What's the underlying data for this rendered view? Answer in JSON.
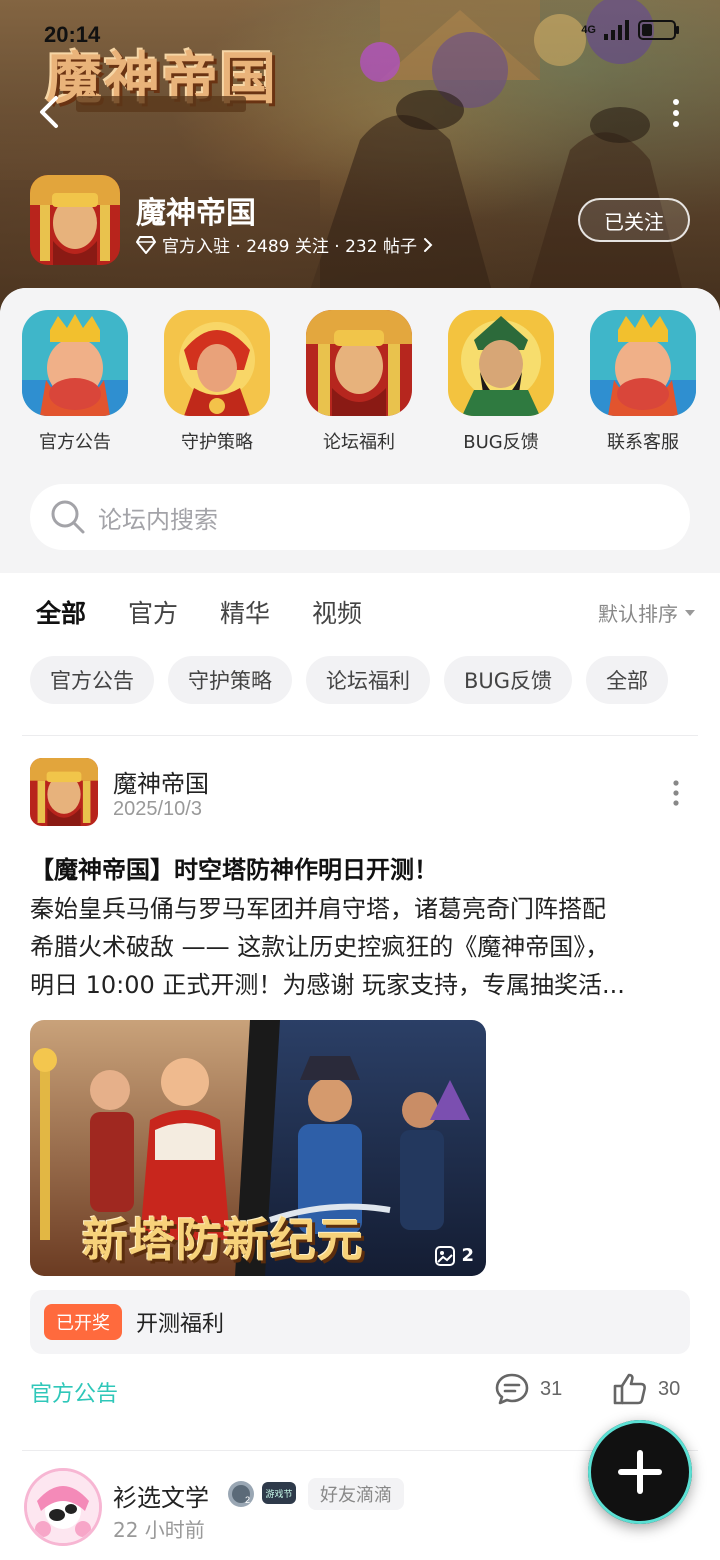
{
  "status": {
    "time": "20:14",
    "network": "4G"
  },
  "header": {
    "logo_text": "魔神帝国",
    "game_name": "魔神帝国",
    "meta": "官方入驻 · 2489 关注 · 232 帖子",
    "follow_label": "已关注"
  },
  "quick_links": [
    {
      "label": "官方公告",
      "icon": "king-icon"
    },
    {
      "label": "守护策略",
      "icon": "red-hero-icon"
    },
    {
      "label": "论坛福利",
      "icon": "emperor-icon"
    },
    {
      "label": "BUG反馈",
      "icon": "guan-yu-icon"
    },
    {
      "label": "联系客服",
      "icon": "king-icon"
    }
  ],
  "search": {
    "placeholder": "论坛内搜索"
  },
  "tabs": [
    "全部",
    "官方",
    "精华",
    "视频"
  ],
  "active_tab": "全部",
  "sort_label": "默认排序",
  "chips": [
    "官方公告",
    "守护策略",
    "论坛福利",
    "BUG反馈",
    "全部"
  ],
  "post": {
    "author": "魔神帝国",
    "date": "2025/10/3",
    "title": "【魔神帝国】时空塔防神作明日开测！",
    "body_lines": [
      "秦始皇兵马俑与罗马军团并肩守塔，诸葛亮奇门阵搭配",
      "希腊火术破敌 —— 这款让历史控疯狂的《魔神帝国》，",
      "明日 10:00 正式开测！为感谢 玩家支持，专属抽奖活..."
    ],
    "image_text": "新塔防新纪元",
    "image_count": "2",
    "lottery_badge": "已开奖",
    "lottery_text": "开测福利",
    "tag": "官方公告",
    "comments": "31",
    "likes": "30"
  },
  "next_post": {
    "author": "衫选文学",
    "time": "22 小时前",
    "friend_tag": "好友滴滴",
    "game_badge": "游戏节"
  },
  "colors": {
    "accent": "#2fd3c2",
    "lottery": "#ff6a3d",
    "tag": "#2fc7b9"
  }
}
